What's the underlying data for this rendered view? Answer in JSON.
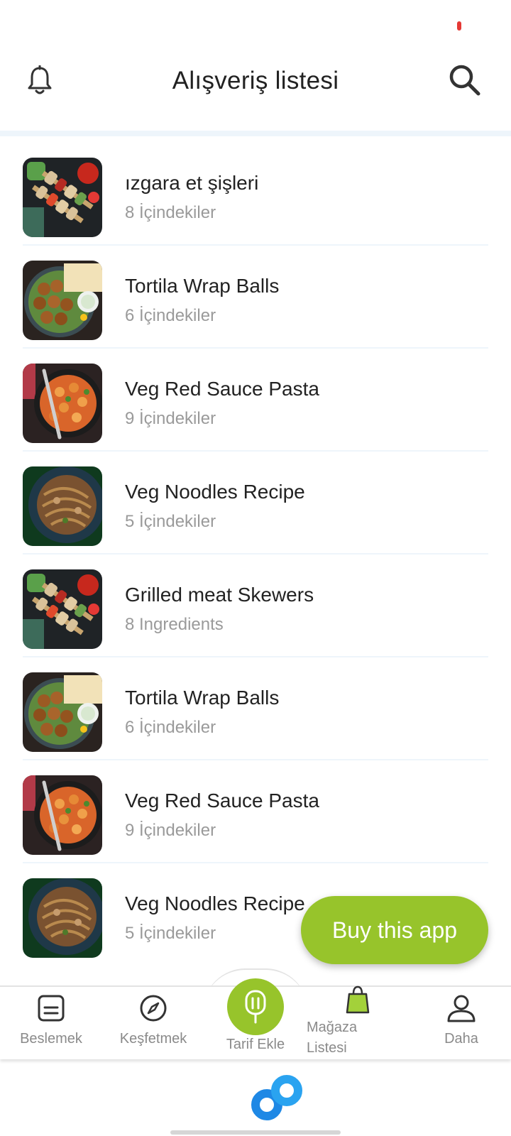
{
  "header": {
    "title": "Alışveriş listesi",
    "left_icon": "bell-icon",
    "right_icon": "search-icon"
  },
  "items": [
    {
      "name": "ızgara et şişleri",
      "meta": "8 İçindekiler",
      "image": "grilled-skewers"
    },
    {
      "name": "Tortila Wrap Balls",
      "meta": "6 İçindekiler",
      "image": "falafel-balls"
    },
    {
      "name": "Veg Red Sauce Pasta",
      "meta": "9 İçindekiler",
      "image": "red-sauce-pasta"
    },
    {
      "name": "Veg Noodles Recipe",
      "meta": "5 İçindekiler",
      "image": "noodles-bowl"
    },
    {
      "name": "Grilled meat Skewers",
      "meta": "8 Ingredients",
      "image": "grilled-skewers"
    },
    {
      "name": "Tortila Wrap Balls",
      "meta": "6 İçindekiler",
      "image": "falafel-balls"
    },
    {
      "name": "Veg Red Sauce Pasta",
      "meta": "9 İçindekiler",
      "image": "red-sauce-pasta"
    },
    {
      "name": "Veg Noodles Recipe",
      "meta": "5 İçindekiler",
      "image": "noodles-bowl"
    }
  ],
  "buy_button": {
    "label": "Buy this app"
  },
  "nav": {
    "feed": {
      "label": "Beslemek",
      "icon": "feed-icon"
    },
    "explore": {
      "label": "Keşfetmek",
      "icon": "compass-icon"
    },
    "add_recipe": {
      "label": "Tarif Ekle",
      "icon": "utensils-icon"
    },
    "shopping": {
      "label_line1": "Mağaza",
      "label_line2": "Listesi",
      "icon": "shopping-bag-icon"
    },
    "more": {
      "label": "Daha",
      "icon": "user-icon"
    }
  },
  "colors": {
    "accent": "#97c42b",
    "text_primary": "#222222",
    "text_secondary": "#9a9a9a",
    "divider": "#eef5fb",
    "logo_blue": "#1e88e5"
  }
}
